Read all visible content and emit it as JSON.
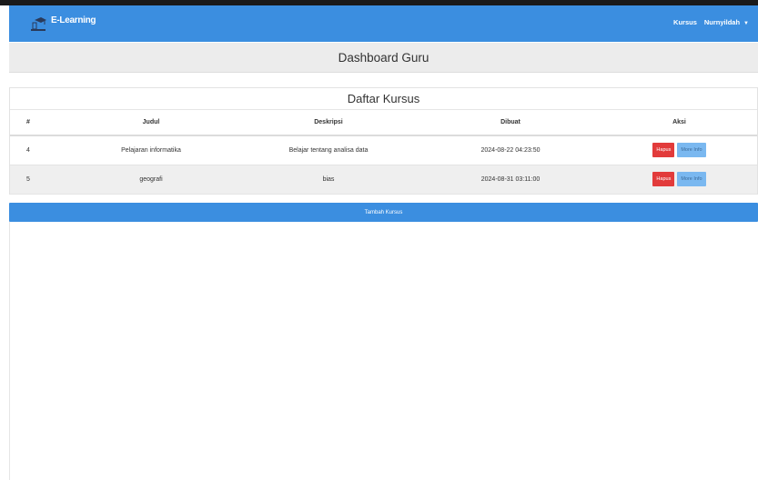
{
  "navbar": {
    "brand": "E-Learning",
    "right_items": [
      "Kursus",
      "Nurnyildah"
    ],
    "accent_color": "#3b8ee0",
    "logo_icon": "graduation-cap-icon"
  },
  "header": {
    "title": "Dashboard Guru"
  },
  "courses": {
    "title": "Daftar Kursus",
    "columns": [
      "#",
      "Judul",
      "Deskripsi",
      "Dibuat",
      "Aksi"
    ],
    "rows": [
      {
        "id": "4",
        "judul": "Pelajaran informatika",
        "deskripsi": "Belajar tentang analisa data",
        "dibuat": "2024-08-22 04:23:50",
        "hapus": "Hapus",
        "more": "More Info"
      },
      {
        "id": "5",
        "judul": "geografi",
        "deskripsi": "bias",
        "dibuat": "2024-08-31 03:11:00",
        "hapus": "Hapus",
        "more": "More Info"
      }
    ]
  },
  "add_button": "Tambah Kursus",
  "colors": {
    "delete": "#e23b3b",
    "info": "#7ab8f0"
  }
}
